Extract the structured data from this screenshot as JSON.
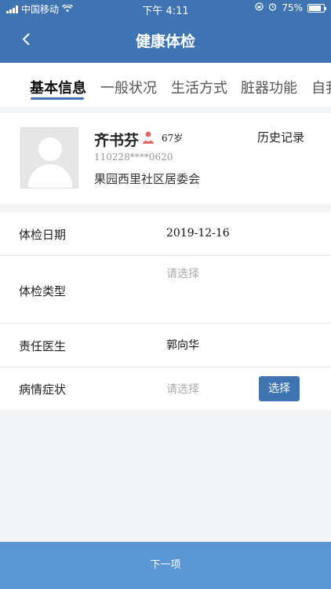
{
  "status_bar": {
    "carrier": "中国移动",
    "time": "下午 4:11",
    "battery": "75%"
  },
  "nav": {
    "title": "健康体检",
    "back_icon": "chevron-left-icon"
  },
  "tabs": [
    {
      "label": "基本信息",
      "active": true
    },
    {
      "label": "一般状况",
      "active": false
    },
    {
      "label": "生活方式",
      "active": false
    },
    {
      "label": "脏器功能",
      "active": false
    },
    {
      "label": "自我",
      "active": false
    }
  ],
  "profile": {
    "name": "齐书芬",
    "gender_icon": "female-person-icon",
    "age": "67岁",
    "id_number": "110228****0620",
    "organization": "果园西里社区居委会",
    "history_label": "历史记录"
  },
  "form": {
    "exam_date": {
      "label": "体检日期",
      "value": "2019-12-16"
    },
    "exam_type": {
      "label": "体检类型",
      "placeholder": "请选择"
    },
    "doctor": {
      "label": "责任医生",
      "value": "郭向华"
    },
    "symptoms": {
      "label": "病情症状",
      "placeholder": "请选择",
      "button": "选择"
    }
  },
  "footer": {
    "next_label": "下一项"
  },
  "colors": {
    "primary": "#3f74b3",
    "footer": "#5b97d4"
  }
}
